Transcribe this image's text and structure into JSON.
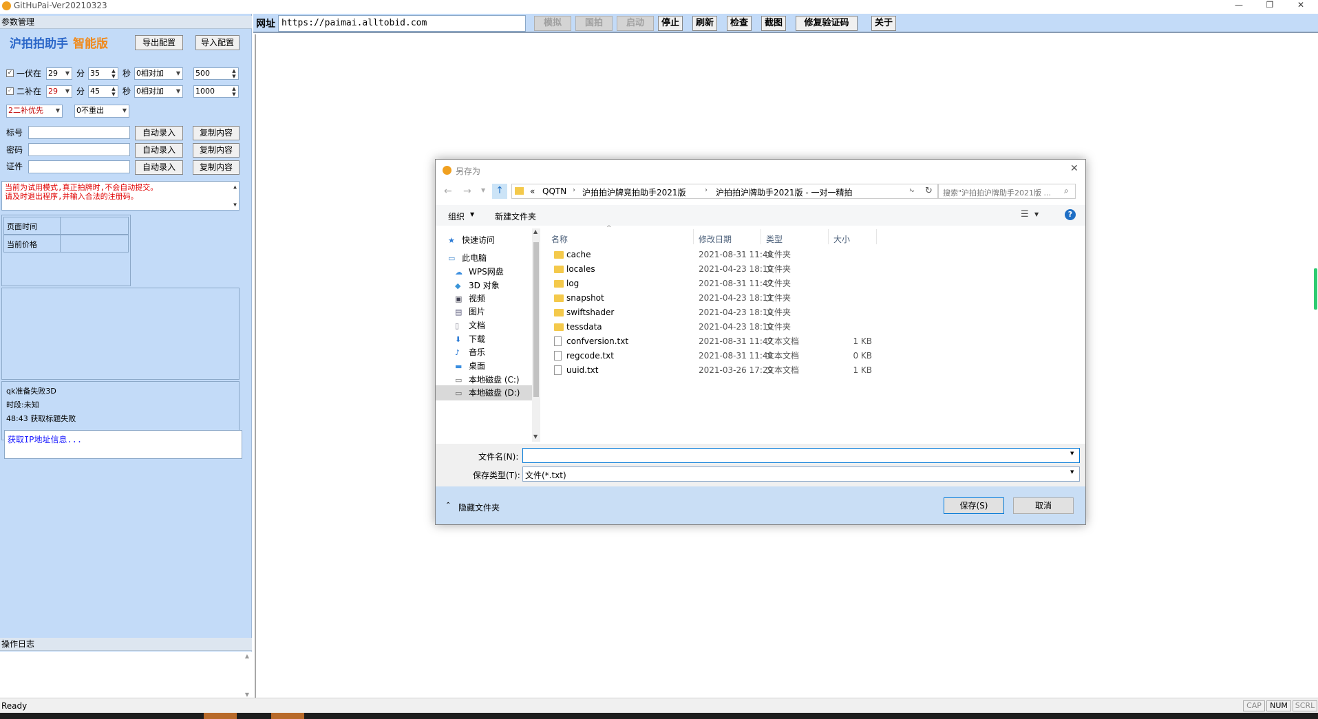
{
  "window": {
    "title": "GitHuPai-Ver20210323"
  },
  "left": {
    "param_header": "参数管理",
    "app_title": "沪拍拍助手",
    "app_edition": "智能版",
    "export_btn": "导出配置",
    "import_btn": "导入配置",
    "row1": {
      "label": "一伏在",
      "min": "29",
      "min_unit": "分",
      "sec": "35",
      "sec_unit": "秒",
      "mode": "0相对加",
      "value": "500"
    },
    "row2": {
      "label": "二补在",
      "min": "29",
      "min_unit": "分",
      "sec": "45",
      "sec_unit": "秒",
      "mode": "0相对加",
      "value": "1000"
    },
    "priority": "2二补优先",
    "repeat": "0不重出",
    "fields": [
      {
        "label": "标号",
        "auto": "自动录入",
        "copy": "复制内容"
      },
      {
        "label": "密码",
        "auto": "自动录入",
        "copy": "复制内容"
      },
      {
        "label": "证件",
        "auto": "自动录入",
        "copy": "复制内容"
      }
    ],
    "notice_line1": "当前为试用模式,真正拍牌时,不会自动提交。",
    "notice_line2": "请及时退出程序,并输入合法的注册码。",
    "page_time_label": "页面时间",
    "current_price_label": "当前价格",
    "log_lines": [
      "qk准备失败3D",
      "时段:未知",
      "48:43 获取标题失败"
    ],
    "ip_info": "获取IP地址信息...",
    "oplog_header": "操作日志"
  },
  "topbar": {
    "url_label": "网址",
    "url": "https://paimai.alltobid.com",
    "buttons": [
      "模拟",
      "国拍",
      "启动",
      "停止",
      "刷新",
      "检查",
      "截图",
      "修复验证码",
      "关于"
    ]
  },
  "status": {
    "ready": "Ready",
    "cap": "CAP",
    "num": "NUM",
    "scrl": "SCRL"
  },
  "dialog": {
    "title": "另存为",
    "breadcrumbs": [
      "«",
      "QQTN",
      "沪拍拍沪牌竞拍助手2021版",
      "沪拍拍沪牌助手2021版 - 一对一精拍"
    ],
    "search_placeholder": "搜索\"沪拍拍沪牌助手2021版 ...",
    "organize": "组织",
    "new_folder": "新建文件夹",
    "nav": [
      {
        "label": "快速访问",
        "icon": "star-icon"
      },
      {
        "label": "此电脑",
        "icon": "computer-icon"
      },
      {
        "label": "WPS网盘",
        "icon": "cloud-icon"
      },
      {
        "label": "3D 对象",
        "icon": "cube-icon"
      },
      {
        "label": "视频",
        "icon": "video-icon"
      },
      {
        "label": "图片",
        "icon": "picture-icon"
      },
      {
        "label": "文档",
        "icon": "document-icon"
      },
      {
        "label": "下载",
        "icon": "download-icon"
      },
      {
        "label": "音乐",
        "icon": "music-icon"
      },
      {
        "label": "桌面",
        "icon": "desktop-icon"
      },
      {
        "label": "本地磁盘 (C:)",
        "icon": "drive-icon"
      },
      {
        "label": "本地磁盘 (D:)",
        "icon": "drive-icon"
      }
    ],
    "columns": [
      "名称",
      "修改日期",
      "类型",
      "大小"
    ],
    "files": [
      {
        "name": "cache",
        "date": "2021-08-31 11:48",
        "type": "文件夹",
        "size": "",
        "kind": "folder"
      },
      {
        "name": "locales",
        "date": "2021-04-23 18:10",
        "type": "文件夹",
        "size": "",
        "kind": "folder"
      },
      {
        "name": "log",
        "date": "2021-08-31 11:47",
        "type": "文件夹",
        "size": "",
        "kind": "folder"
      },
      {
        "name": "snapshot",
        "date": "2021-04-23 18:11",
        "type": "文件夹",
        "size": "",
        "kind": "folder"
      },
      {
        "name": "swiftshader",
        "date": "2021-04-23 18:10",
        "type": "文件夹",
        "size": "",
        "kind": "folder"
      },
      {
        "name": "tessdata",
        "date": "2021-04-23 18:10",
        "type": "文件夹",
        "size": "",
        "kind": "folder"
      },
      {
        "name": "confversion.txt",
        "date": "2021-08-31 11:47",
        "type": "文本文档",
        "size": "1 KB",
        "kind": "txt"
      },
      {
        "name": "regcode.txt",
        "date": "2021-08-31 11:48",
        "type": "文本文档",
        "size": "0 KB",
        "kind": "txt"
      },
      {
        "name": "uuid.txt",
        "date": "2021-03-26 17:29",
        "type": "文本文档",
        "size": "1 KB",
        "kind": "txt"
      }
    ],
    "filename_label": "文件名(N):",
    "filename_value": "",
    "filetype_label": "保存类型(T):",
    "filetype_value": "文件(*.txt)",
    "hide_folders": "隐藏文件夹",
    "save_btn": "保存(S)",
    "cancel_btn": "取消"
  }
}
